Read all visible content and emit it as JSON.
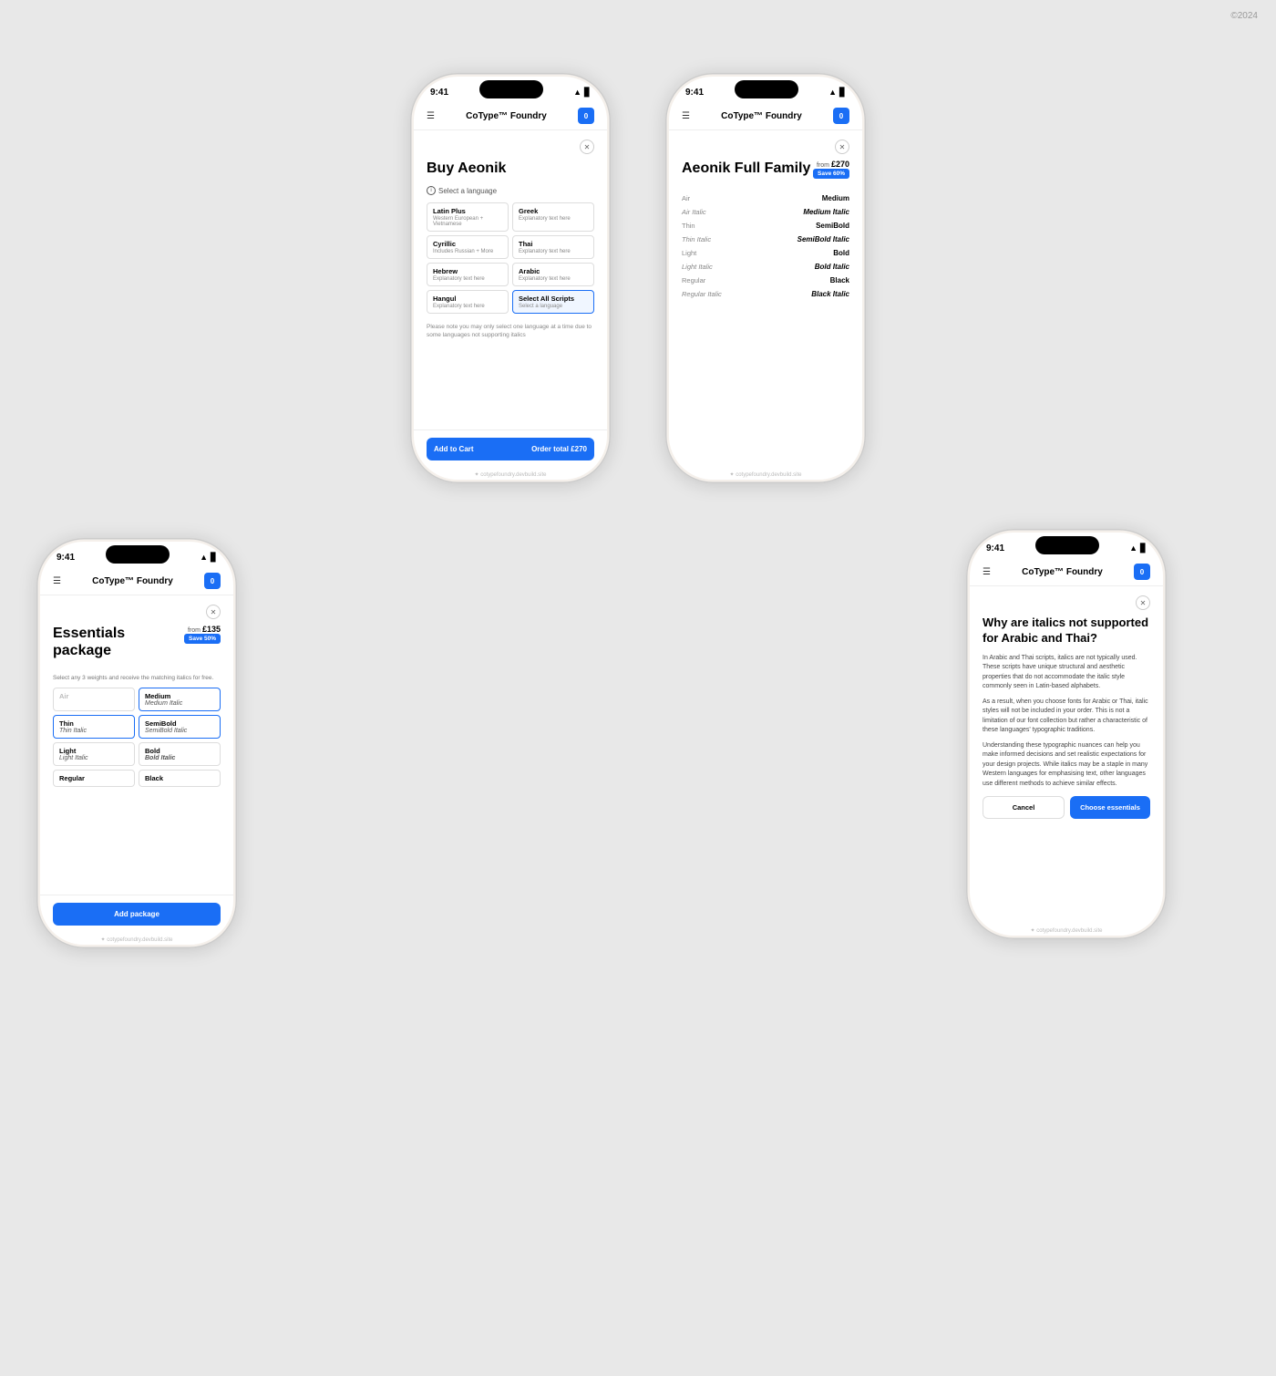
{
  "copyright": "©2024",
  "phones": {
    "phone1": {
      "time": "9:41",
      "nav_title": "CoType™ Foundry",
      "cart_count": "0",
      "modal_title": "Buy Aeonik",
      "section_label": "Select a language",
      "languages": [
        {
          "name": "Latin Plus",
          "sub": "Western European + Vietnamese"
        },
        {
          "name": "Greek",
          "sub": "Explanatory text here"
        },
        {
          "name": "Cyrillic",
          "sub": "Includes Russian + More"
        },
        {
          "name": "Thai",
          "sub": "Explanatory text here"
        },
        {
          "name": "Hebrew",
          "sub": "Explanatory text here"
        },
        {
          "name": "Arabic",
          "sub": "Explanatory text here"
        },
        {
          "name": "Hangul",
          "sub": "Explanatory text here"
        },
        {
          "name": "Select All Scripts",
          "sub": "Select a language"
        }
      ],
      "note": "Please note you may only select one language at a time due to some languages not supporting italics",
      "btn_label": "Add to Cart",
      "order_total_label": "Order total",
      "order_total": "£270",
      "url": "✦ cotypefoundry.devbuild.site"
    },
    "phone2": {
      "time": "9:41",
      "nav_title": "CoType™ Foundry",
      "cart_count": "0",
      "modal_title": "Aeonik Full Family",
      "from_label": "from",
      "price": "£270",
      "save_badge": "Save 60%",
      "fonts": [
        {
          "label": "Air",
          "name": "Medium",
          "label_italic": false,
          "name_italic": false
        },
        {
          "label": "Air Italic",
          "name": "Medium Italic",
          "label_italic": true,
          "name_italic": true
        },
        {
          "label": "Thin",
          "name": "SemiBold",
          "label_italic": false,
          "name_italic": false
        },
        {
          "label": "Thin Italic",
          "name": "SemiBold Italic",
          "label_italic": true,
          "name_italic": true
        },
        {
          "label": "Light",
          "name": "Bold",
          "label_italic": false,
          "name_italic": false
        },
        {
          "label": "Light Italic",
          "name": "Bold Italic",
          "label_italic": true,
          "name_italic": true
        },
        {
          "label": "Regular",
          "name": "Black",
          "label_italic": false,
          "name_italic": false
        },
        {
          "label": "Regular Italic",
          "name": "Black Italic",
          "label_italic": true,
          "name_italic": true
        }
      ],
      "url": "✦ cotypefoundry.devbuild.site"
    },
    "phone3": {
      "time": "9:41",
      "nav_title": "CoType™ Foundry",
      "cart_count": "0",
      "modal_title": "Essentials package",
      "from_label": "from",
      "price": "£135",
      "save_badge": "Save 50%",
      "select_note": "Select any 3 weights and receive the matching italics for free.",
      "packages": [
        {
          "col1_name": "Air",
          "col1_italic": "",
          "col2_name": "Medium",
          "col2_italic": "Medium Italic",
          "col1_faded": true,
          "col2_selected": true
        },
        {
          "col1_name": "Thin",
          "col1_italic": "Thin Italic",
          "col2_name": "SemiBold",
          "col2_italic": "SemiBold Italic",
          "col1_selected": true,
          "col2_selected": true
        },
        {
          "col1_name": "Light",
          "col1_italic": "Light Italic",
          "col2_name": "Bold",
          "col2_italic": "Bold Italic",
          "col1_selected": false,
          "col2_selected": false
        },
        {
          "col1_name": "Regular",
          "col1_italic": "",
          "col2_name": "Black",
          "col2_italic": "",
          "col1_selected": false,
          "col2_selected": false
        }
      ],
      "btn_label": "Add package",
      "url": "✦ cotypefoundry.devbuild.site"
    },
    "phone4": {
      "time": "9:41",
      "nav_title": "CoType™ Foundry",
      "cart_count": "0",
      "faq_title": "Why are italics not supported for Arabic and Thai?",
      "faq_paragraphs": [
        "In Arabic and Thai scripts, italics are not typically used. These scripts have unique structural and aesthetic properties that do not accommodate the italic style commonly seen in Latin-based alphabets.",
        "As a result, when you choose fonts for Arabic or Thai, italic styles will not be included in your order. This is not a limitation of our font collection but rather a characteristic of these languages' typographic traditions.",
        "Understanding these typographic nuances can help you make informed decisions and set realistic expectations for your design projects. While italics may be a staple in many Western languages for emphasising text, other languages use different methods to achieve similar effects."
      ],
      "btn_cancel": "Cancel",
      "btn_choose": "Choose essentials",
      "url": "✦ cotypefoundry.devbuild.site"
    }
  }
}
